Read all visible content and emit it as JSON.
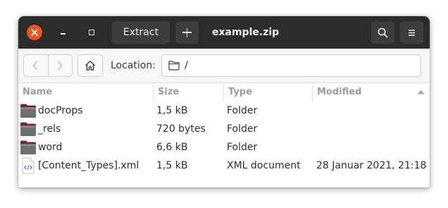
{
  "window": {
    "title": "example.zip",
    "extract_label": "Extract",
    "close_color": "#e95420"
  },
  "toolbar": {
    "location_label": "Location:",
    "location_value": "/"
  },
  "columns": [
    "Name",
    "Size",
    "Type",
    "Modified"
  ],
  "sort": {
    "column": "Modified",
    "direction": "ascending"
  },
  "files": [
    {
      "name": "docProps",
      "size": "1,5 kB",
      "type": "Folder",
      "modified": "",
      "icon": "folder-icon"
    },
    {
      "name": "_rels",
      "size": "720 bytes",
      "type": "Folder",
      "modified": "",
      "icon": "folder-icon"
    },
    {
      "name": "word",
      "size": "6,6 kB",
      "type": "Folder",
      "modified": "",
      "icon": "folder-icon"
    },
    {
      "name": "[Content_Types].xml",
      "size": "1,5 kB",
      "type": "XML document",
      "modified": "28 Januar 2021, 21:18",
      "icon": "xml-file-icon"
    }
  ]
}
